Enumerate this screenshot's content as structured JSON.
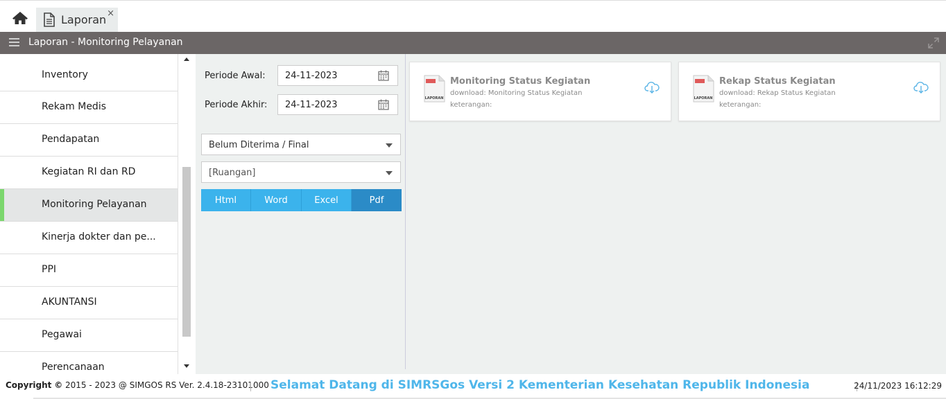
{
  "tabs": [
    {
      "label": "Laporan",
      "close": "×"
    }
  ],
  "header": {
    "title": "Laporan - Monitoring Pelayanan"
  },
  "sidebar": {
    "items": [
      {
        "label": "Inventory"
      },
      {
        "label": "Rekam Medis"
      },
      {
        "label": "Pendapatan"
      },
      {
        "label": "Kegiatan RI dan RD"
      },
      {
        "label": "Monitoring Pelayanan",
        "active": true
      },
      {
        "label": "Kinerja dokter dan pe..."
      },
      {
        "label": "PPI"
      },
      {
        "label": "AKUNTANSI"
      },
      {
        "label": "Pegawai"
      },
      {
        "label": "Perencanaan"
      }
    ]
  },
  "form": {
    "periode_awal_label": "Periode Awal:",
    "periode_awal_value": "24-11-2023",
    "periode_akhir_label": "Periode Akhir:",
    "periode_akhir_value": "24-11-2023",
    "status_select": "Belum Diterima / Final",
    "ruangan_select": "[Ruangan]",
    "format_buttons": [
      {
        "label": "Html"
      },
      {
        "label": "Word"
      },
      {
        "label": "Excel"
      },
      {
        "label": "Pdf",
        "selected": true
      }
    ]
  },
  "reports": [
    {
      "title": "Monitoring Status Kegiatan",
      "download": "download: Monitoring Status Kegiatan",
      "keterangan": "keterangan:"
    },
    {
      "title": "Rekap Status Kegiatan",
      "download": "download: Rekap Status Kegiatan",
      "keterangan": "keterangan:"
    }
  ],
  "doc_icon_text": "LAPORAN",
  "footer": {
    "copyright_label": "Copyright",
    "copyright_symbol": "©",
    "copyright_text": "2015 - 2023 @ SIMGOS RS Ver. 2.4.18-23101000",
    "welcome": "Selamat Datang di SIMRSGos Versi 2 Kementerian Kesehatan Republik Indonesia",
    "datetime": "24/11/2023 16:12:29"
  },
  "colors": {
    "accent": "#3bb3ec",
    "accent_active": "#2b8bc7",
    "header_bg": "#6b6666",
    "active_marker": "#7bd76d",
    "welcome_text": "#4fb6ea"
  },
  "icons": [
    "home-icon",
    "document-icon",
    "close-icon",
    "hamburger-menu-icon",
    "expand-icon",
    "calendar-icon",
    "chevron-down-icon",
    "report-document-icon",
    "cloud-download-icon"
  ]
}
